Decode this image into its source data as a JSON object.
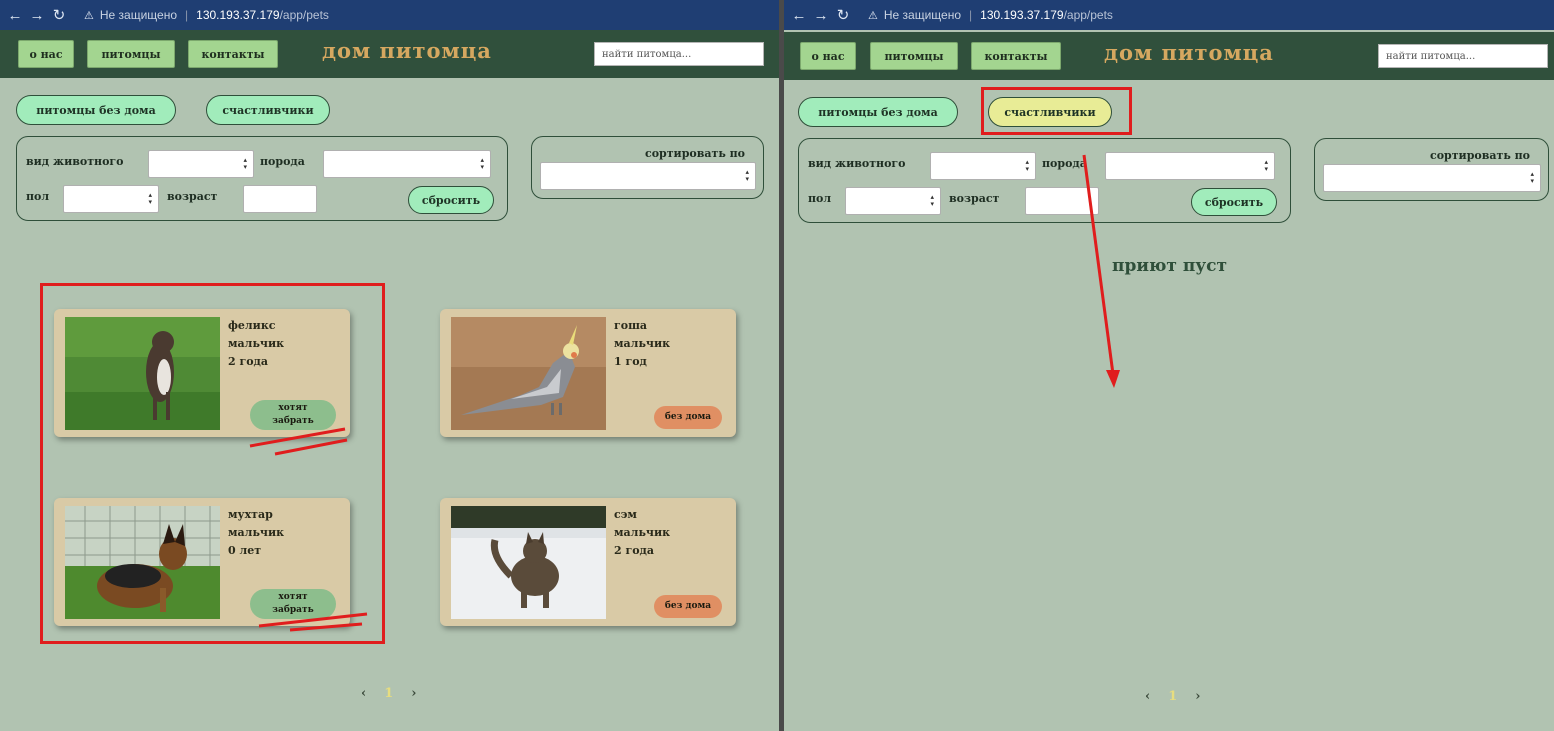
{
  "browser": {
    "security_warning": "Не защищено",
    "url_host": "130.193.37.179",
    "url_path": "/app/pets"
  },
  "header": {
    "nav": [
      "О НАС",
      "ПИТОМЦЫ",
      "КОНТАКТЫ"
    ],
    "brand": "ДОМ ПИТОМЦА",
    "search_placeholder": "найти питомца..."
  },
  "tabs": {
    "homeless": "питомцы без дома",
    "lucky": "счастливчики"
  },
  "filters": {
    "species_label": "вид животного",
    "breed_label": "порода",
    "sex_label": "пол",
    "age_label": "возраст",
    "reset_label": "сбросить",
    "sort_label": "сортировать по"
  },
  "left_panel": {
    "pets": [
      {
        "name": "феликс",
        "sex": "мальчик",
        "age": "2 года",
        "status_line1": "хотят",
        "status_line2": "забрать",
        "photo_icon": "dog-photo"
      },
      {
        "name": "гоша",
        "sex": "мальчик",
        "age": "1 год",
        "status_line1": "без дома",
        "photo_icon": "parrot-photo"
      },
      {
        "name": "мухтар",
        "sex": "мальчик",
        "age": "0 лет",
        "status_line1": "хотят",
        "status_line2": "забрать",
        "photo_icon": "puppy-photo"
      },
      {
        "name": "сэм",
        "sex": "мальчик",
        "age": "2 года",
        "status_line1": "без дома",
        "photo_icon": "cat-photo"
      }
    ],
    "pager": {
      "prev": "‹",
      "page": "1",
      "next": "›"
    }
  },
  "right_panel": {
    "empty_message": "приют пуст",
    "pager": {
      "prev": "‹",
      "page": "1",
      "next": "›"
    }
  },
  "colors": {
    "background": "#b1c3b1",
    "header": "#30503c",
    "brand": "#d6a860",
    "nav_button": "#a3d590",
    "tab": "#a1ecbb",
    "tab_active": "#e8ec96",
    "card": "#d9caa6",
    "status_want": "#8dbe8d",
    "status_homeless": "#e08f63",
    "annotation_red": "#e01d1d"
  }
}
